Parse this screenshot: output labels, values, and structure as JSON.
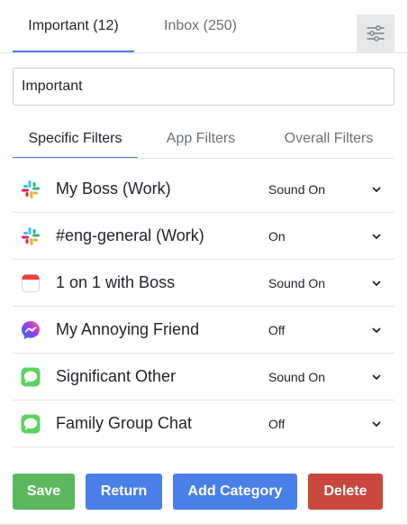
{
  "top_tabs": [
    {
      "label": "Important (12)",
      "active": true
    },
    {
      "label": "Inbox (250)",
      "active": false
    }
  ],
  "settings_icon": "sliders-icon",
  "category": {
    "name_value": "Important"
  },
  "filter_tabs": [
    {
      "label": "Specific Filters",
      "active": true
    },
    {
      "label": "App Filters",
      "active": false
    },
    {
      "label": "Overall Filters",
      "active": false
    }
  ],
  "filters": [
    {
      "icon": "slack-icon",
      "label": "My Boss (Work)",
      "setting": "Sound On"
    },
    {
      "icon": "slack-icon",
      "label": "#eng-general (Work)",
      "setting": "On"
    },
    {
      "icon": "calendar-icon",
      "label": "1 on 1 with Boss",
      "setting": "Sound On"
    },
    {
      "icon": "messenger-icon",
      "label": "My Annoying Friend",
      "setting": "Off"
    },
    {
      "icon": "messages-icon",
      "label": "Significant Other",
      "setting": "Sound On"
    },
    {
      "icon": "messages-icon",
      "label": "Family Group Chat",
      "setting": "Off"
    }
  ],
  "buttons": {
    "save": {
      "label": "Save",
      "color": "#5cb85c"
    },
    "return": {
      "label": "Return",
      "color": "#4a7fe8"
    },
    "add_category": {
      "label": "Add Category",
      "color": "#4a7fe8"
    },
    "delete": {
      "label": "Delete",
      "color": "#c9473c"
    }
  },
  "colors": {
    "accent": "#4a7fe8",
    "text": "#1f2328",
    "muted_text": "#6b7075",
    "divider": "#e3e3e3"
  }
}
